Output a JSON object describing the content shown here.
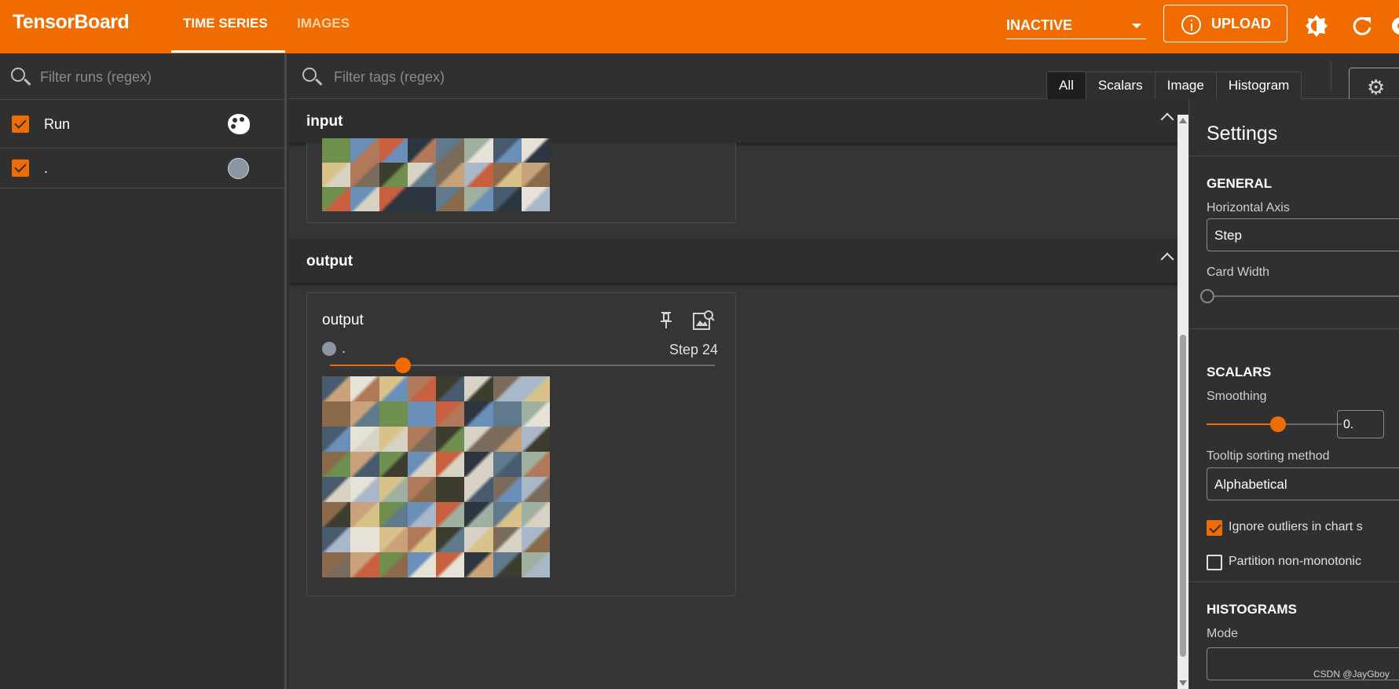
{
  "app": {
    "title": "TensorBoard",
    "colors": {
      "accent": "#f06c00",
      "background": "#303030"
    }
  },
  "nav": {
    "tabs": [
      {
        "label": "TIME SERIES",
        "active": true
      },
      {
        "label": "IMAGES",
        "active": false
      }
    ]
  },
  "header": {
    "status_select": "INACTIVE",
    "upload_label": "UPLOAD",
    "icons": [
      "info-icon",
      "theme-toggle-icon",
      "refresh-icon",
      "settings-icon"
    ]
  },
  "runs": {
    "filter_placeholder": "Filter runs (regex)",
    "header_label": "Run",
    "items": [
      {
        "label": ".",
        "checked": true,
        "color": "#8c96a3"
      }
    ]
  },
  "tags": {
    "filter_placeholder": "Filter tags (regex)",
    "chips": [
      "All",
      "Scalars",
      "Image",
      "Histogram"
    ],
    "active_chip": "All"
  },
  "groups": [
    {
      "title": "input"
    },
    {
      "title": "output",
      "card": {
        "title": "output",
        "run_label": ".",
        "step_label": "Step 24",
        "step_fraction": 0.22
      }
    }
  ],
  "settings": {
    "title": "Settings",
    "general": {
      "heading": "GENERAL",
      "horizontal_axis_label": "Horizontal Axis",
      "horizontal_axis_value": "Step",
      "card_width_label": "Card Width"
    },
    "scalars": {
      "heading": "SCALARS",
      "smoothing_label": "Smoothing",
      "smoothing_value": "0.",
      "smoothing_fraction": 0.6,
      "tooltip_sort_label": "Tooltip sorting method",
      "tooltip_sort_value": "Alphabetical",
      "ignore_outliers_label": "Ignore outliers in chart s",
      "ignore_outliers_checked": true,
      "partition_label": "Partition non-monotonic",
      "partition_checked": false
    },
    "histograms": {
      "heading": "HISTOGRAMS",
      "mode_label": "Mode"
    }
  },
  "watermark": "CSDN @JayGboy"
}
